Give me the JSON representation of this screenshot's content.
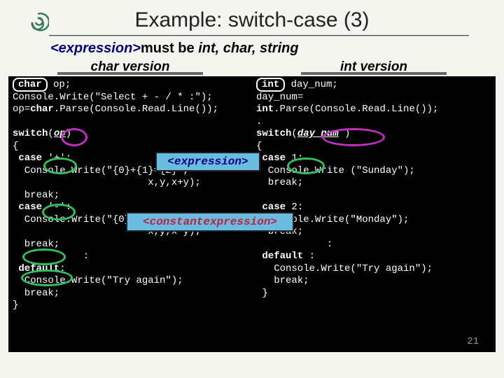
{
  "title": "Example: switch-case (3)",
  "subtitle": {
    "expr": "<expression>",
    "must": "must be",
    "types": "int, char, string"
  },
  "versions": {
    "left": "char version",
    "right": "int version"
  },
  "code_left": {
    "l1a": "char",
    "l1b": " op;",
    "l2": "Console.Write(\"Select + - / * :\");",
    "l3a": "op=",
    "l3b": "char",
    "l3c": ".Parse(Console.Read.Line());",
    "l4": "",
    "l5a": "switch",
    "l5b": "(",
    "l5c": "op",
    "l5d": ")",
    "l6": "{",
    "l7a": " case",
    "l7b": " '+':",
    "l8": "  Console.Write(\"{0}+{1}={2}\",",
    "l9": "                       x,y,x+y);",
    "l10": "  break;",
    "l11a": " case",
    "l11b": " '-':",
    "l12": "  Console.Write(\"{0}-{1}={2}\",",
    "l13": "                       x,y,x-y);",
    "l14": "  break;",
    "l15": "            :",
    "l16a": " default",
    "l16b": ":",
    "l17": "  Console.Write(\"Try again\");",
    "l18": "  break;",
    "l19": "}"
  },
  "code_right": {
    "r1a": "int",
    "r1b": " day_num;",
    "r2": "day_num=",
    "r3a": "int",
    "r3b": ".Parse(Console.Read.Line());",
    "r4": ".",
    "r5a": "switch",
    "r5b": "(",
    "r5c": "day_num",
    "r5d": " )",
    "r6": "{",
    "r7a": " case",
    "r7b": " 1:",
    "r8": "  Console.Write (\"Sunday\");",
    "r9": "  break;",
    "r10": "",
    "r11a": " case",
    "r11b": " 2:",
    "r12": "  console.Write(\"Monday\");",
    "r13": "  break;",
    "r14": "            :",
    "r15a": " default ",
    "r15b": ":",
    "r16": "   Console.Write(\"Try again\");",
    "r17": "   break;",
    "r18": " }"
  },
  "callouts": {
    "expression": "<expression>",
    "constant": "<constantexpression>"
  },
  "slide_number": "21"
}
